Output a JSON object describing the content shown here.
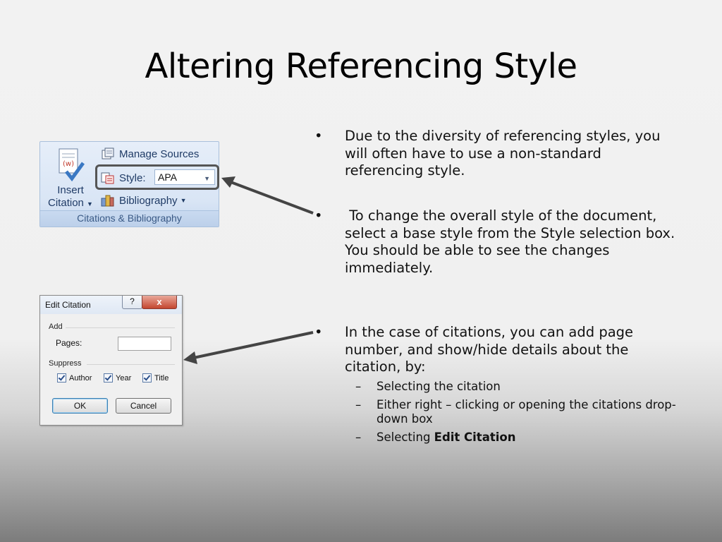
{
  "slide": {
    "title": "Altering Referencing Style",
    "bullets": [
      "Due to the diversity of referencing styles, you will often have to use a non-standard referencing style.",
      " To change the overall style of the document, select a base style from the Style selection box. You should be able to see the changes immediately.",
      "In the case of citations, you can add page number, and show/hide details about the citation, by:"
    ],
    "sub_bullets": [
      "Selecting the citation",
      "Either right – clicking or opening the citations drop-down box"
    ],
    "sub_bullet_last": {
      "prefix": "Selecting ",
      "bold": "Edit Citation"
    },
    "bullet_marker": "•",
    "sub_marker": "–"
  },
  "ribbon": {
    "insert_label_1": "Insert",
    "insert_label_2": "Citation",
    "manage_sources": "Manage Sources",
    "style_label": "Style:",
    "style_value": "APA",
    "bibliography": "Bibliography",
    "group_label": "Citations & Bibliography",
    "icons": [
      "insert-citation-icon",
      "manage-sources-icon",
      "style-icon",
      "bibliography-icon"
    ],
    "accent_color": "#1f3b66"
  },
  "dialog": {
    "title": "Edit Citation",
    "help": "?",
    "close": "x",
    "add_section": "Add",
    "pages_label": "Pages:",
    "pages_value": "",
    "suppress_section": "Suppress",
    "checkboxes": [
      {
        "label": "Author",
        "checked": true
      },
      {
        "label": "Year",
        "checked": true
      },
      {
        "label": "Title",
        "checked": true
      }
    ],
    "ok": "OK",
    "cancel": "Cancel"
  }
}
